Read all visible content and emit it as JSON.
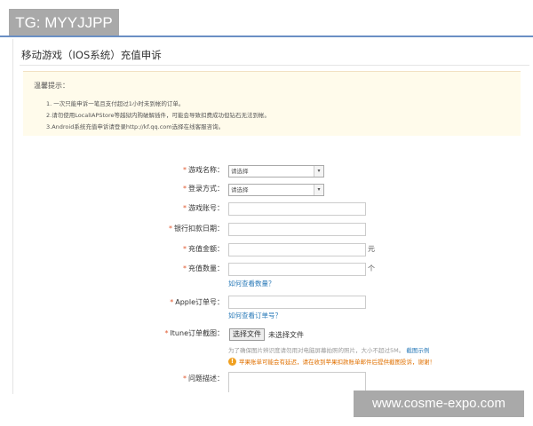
{
  "banner": "TG: MYYJJPP",
  "title": "移动游戏（IOS系统）充值申诉",
  "notice": {
    "heading": "温馨提示：",
    "lines": [
      "1. 一次只能申诉一笔且支付超过1小时未到帐的订单。",
      "2.请勿使用LocalIAPStore等越狱内购破解插件，可能会导致扣费成功但钻石无法到帐。",
      "3.Android系统充值申诉请登录http://kf.qq.com选择在线客服咨询。"
    ]
  },
  "required_mark": "*",
  "form": {
    "game_name": {
      "label": "游戏名称：",
      "value": "请选择"
    },
    "login": {
      "label": "登录方式：",
      "value": "请选择"
    },
    "account": {
      "label": "游戏账号："
    },
    "date": {
      "label": "银行扣款日期："
    },
    "amount": {
      "label": "充值金额：",
      "unit": "元"
    },
    "quantity": {
      "label": "充值数量：",
      "unit": "个",
      "help": "如何查看数量？"
    },
    "apple_order": {
      "label": "Apple订单号：",
      "help": "如何查看订单号？"
    },
    "screenshot": {
      "label": "Itune订单截图：",
      "button": "选择文件",
      "status": "未选择文件",
      "hint": "为了确保图片辨识度请勿用对电脑屏幕拍照的照片，大小不超过5M。",
      "example": "截图示例",
      "warning": "苹果账单可能会有延迟，请在收到苹果扣款账单邮件后提供截图投诉，谢谢！"
    },
    "description": {
      "label": "问题描述："
    }
  },
  "watermark": "www.cosme-expo.com"
}
